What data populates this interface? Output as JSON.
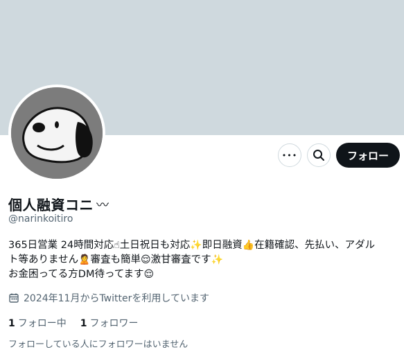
{
  "profile": {
    "display_name": "個人融資コニ",
    "display_name_suffix": "〰",
    "handle": "@narinkoitiro",
    "bio_line1_a": "365日営業 24時間対応",
    "bio_line1_b": "土日祝日も対応",
    "bio_line1_c": "即日融資",
    "bio_line1_d": "在籍確認、先払い、アダル",
    "bio_line2_a": "ト等ありません",
    "bio_line2_b": "審査も簡単",
    "bio_line2_c": "激甘審査です",
    "bio_line3_a": "お金困ってる方DM待ってます",
    "joined": "2024年11月からTwitterを利用しています"
  },
  "emojis": {
    "pointing_up": "☝",
    "sparkles": "✨",
    "thumbs_up": "👍",
    "person": "🙎",
    "relieved": "😌"
  },
  "buttons": {
    "more": "•••",
    "follow": "フォロー"
  },
  "stats": {
    "following_count": "1",
    "following_label": "フォロー中",
    "followers_count": "1",
    "followers_label": "フォロワー"
  },
  "notice": "フォローしている人にフォロワーはいません",
  "colors": {
    "banner": "#cfd9de",
    "follow_button": "#0f1419",
    "secondary_text": "#536471"
  }
}
